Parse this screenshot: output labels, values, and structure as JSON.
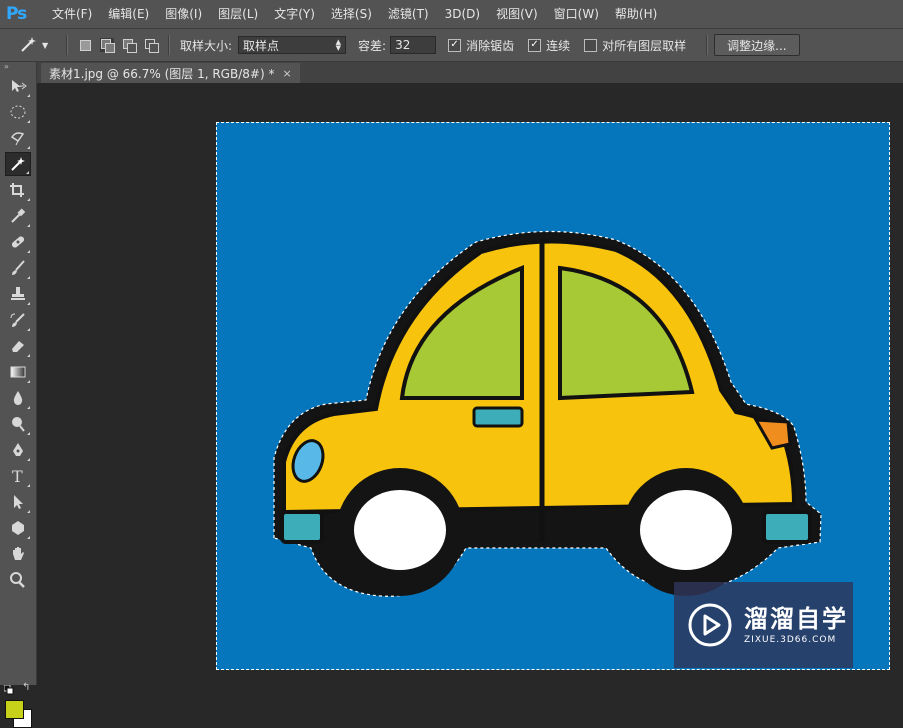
{
  "app": {
    "logo": "Ps"
  },
  "menu": [
    "文件(F)",
    "编辑(E)",
    "图像(I)",
    "图层(L)",
    "文字(Y)",
    "选择(S)",
    "滤镜(T)",
    "3D(D)",
    "视图(V)",
    "窗口(W)",
    "帮助(H)"
  ],
  "options": {
    "sample_size_label": "取样大小:",
    "sample_size_value": "取样点",
    "tolerance_label": "容差:",
    "tolerance_value": "32",
    "antialias_label": "消除锯齿",
    "antialias_checked": true,
    "contiguous_label": "连续",
    "contiguous_checked": true,
    "sample_all_layers_label": "对所有图层取样",
    "sample_all_layers_checked": false,
    "refine_edge_label": "调整边缘..."
  },
  "document": {
    "tab_title": "素材1.jpg @ 66.7% (图层 1, RGB/8#) *",
    "close_glyph": "×"
  },
  "colors": {
    "foreground": "#c8d11a",
    "background": "#ffffff",
    "canvas_bg": "#0575bc",
    "car_body": "#f7c30c",
    "car_window": "#a8c936",
    "car_accent": "#3daeb9",
    "car_taillight": "#f08d1f"
  },
  "tools": [
    "move-icon",
    "marquee-icon",
    "lasso-icon",
    "magic-wand-icon",
    "crop-icon",
    "eyedropper-icon",
    "healing-brush-icon",
    "brush-icon",
    "clone-stamp-icon",
    "history-brush-icon",
    "eraser-icon",
    "gradient-icon",
    "blur-icon",
    "dodge-icon",
    "pen-icon",
    "type-icon",
    "path-selection-icon",
    "shape-icon",
    "hand-icon",
    "zoom-icon"
  ],
  "watermark": {
    "title": "溜溜自学",
    "subtitle": "ZIXUE.3D66.COM"
  }
}
